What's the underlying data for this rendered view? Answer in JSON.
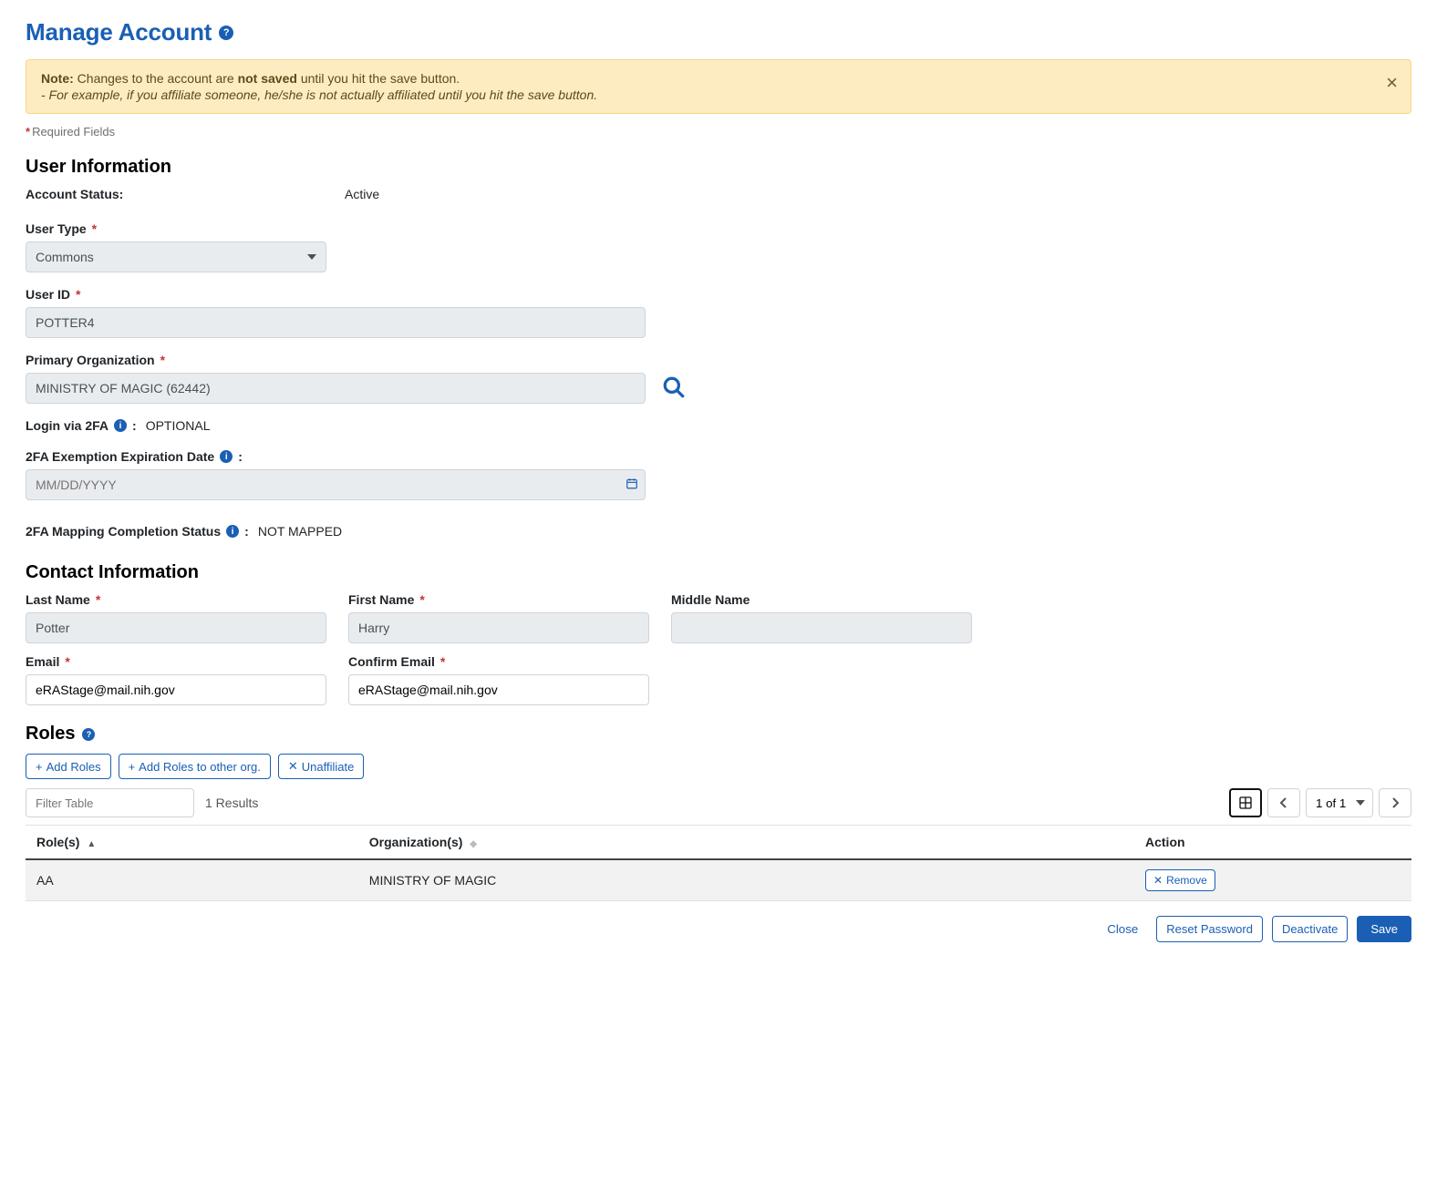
{
  "page": {
    "title": "Manage Account"
  },
  "alert": {
    "note_label": "Note:",
    "line1_a": "Changes to the account are ",
    "line1_b_strong": "not saved",
    "line1_c": " until you hit the save button.",
    "line2": "- For example, if you affiliate someone, he/she is not actually affiliated until you hit the save button."
  },
  "required_hint": "Required Fields",
  "sections": {
    "user_info": "User Information",
    "contact_info": "Contact Information",
    "roles": "Roles"
  },
  "user_info": {
    "account_status_label": "Account Status:",
    "account_status_value": "Active",
    "user_type_label": "User Type",
    "user_type_selected": "Commons",
    "user_id_label": "User ID",
    "user_id_value": "POTTER4",
    "primary_org_label": "Primary Organization",
    "primary_org_value": "MINISTRY OF MAGIC (62442)",
    "twofa_label": "Login via 2FA",
    "twofa_value": "OPTIONAL",
    "twofa_exemption_label": "2FA Exemption Expiration Date",
    "twofa_exemption_placeholder": "MM/DD/YYYY",
    "twofa_mapping_label": "2FA Mapping Completion Status",
    "twofa_mapping_value": "NOT MAPPED",
    "colon": ":"
  },
  "contact": {
    "last_name_label": "Last Name",
    "last_name_value": "Potter",
    "first_name_label": "First Name",
    "first_name_value": "Harry",
    "middle_name_label": "Middle Name",
    "middle_name_value": "",
    "email_label": "Email",
    "email_value": "eRAStage@mail.nih.gov",
    "confirm_email_label": "Confirm Email",
    "confirm_email_value": "eRAStage@mail.nih.gov"
  },
  "roles": {
    "buttons": {
      "add_roles": "Add Roles",
      "add_roles_other_org": "Add Roles to other org.",
      "unaffiliate": "Unaffiliate"
    },
    "filter_placeholder": "Filter Table",
    "results_text": "1 Results",
    "pager_text": "1 of 1",
    "columns": {
      "roles": "Role(s)",
      "orgs": "Organization(s)",
      "action": "Action"
    },
    "rows": [
      {
        "role": "AA",
        "org": "MINISTRY OF MAGIC"
      }
    ],
    "row_actions": {
      "remove": "Remove"
    }
  },
  "footer": {
    "close": "Close",
    "reset_password": "Reset Password",
    "deactivate": "Deactivate",
    "save": "Save"
  },
  "symbols": {
    "asterisk": "*"
  }
}
